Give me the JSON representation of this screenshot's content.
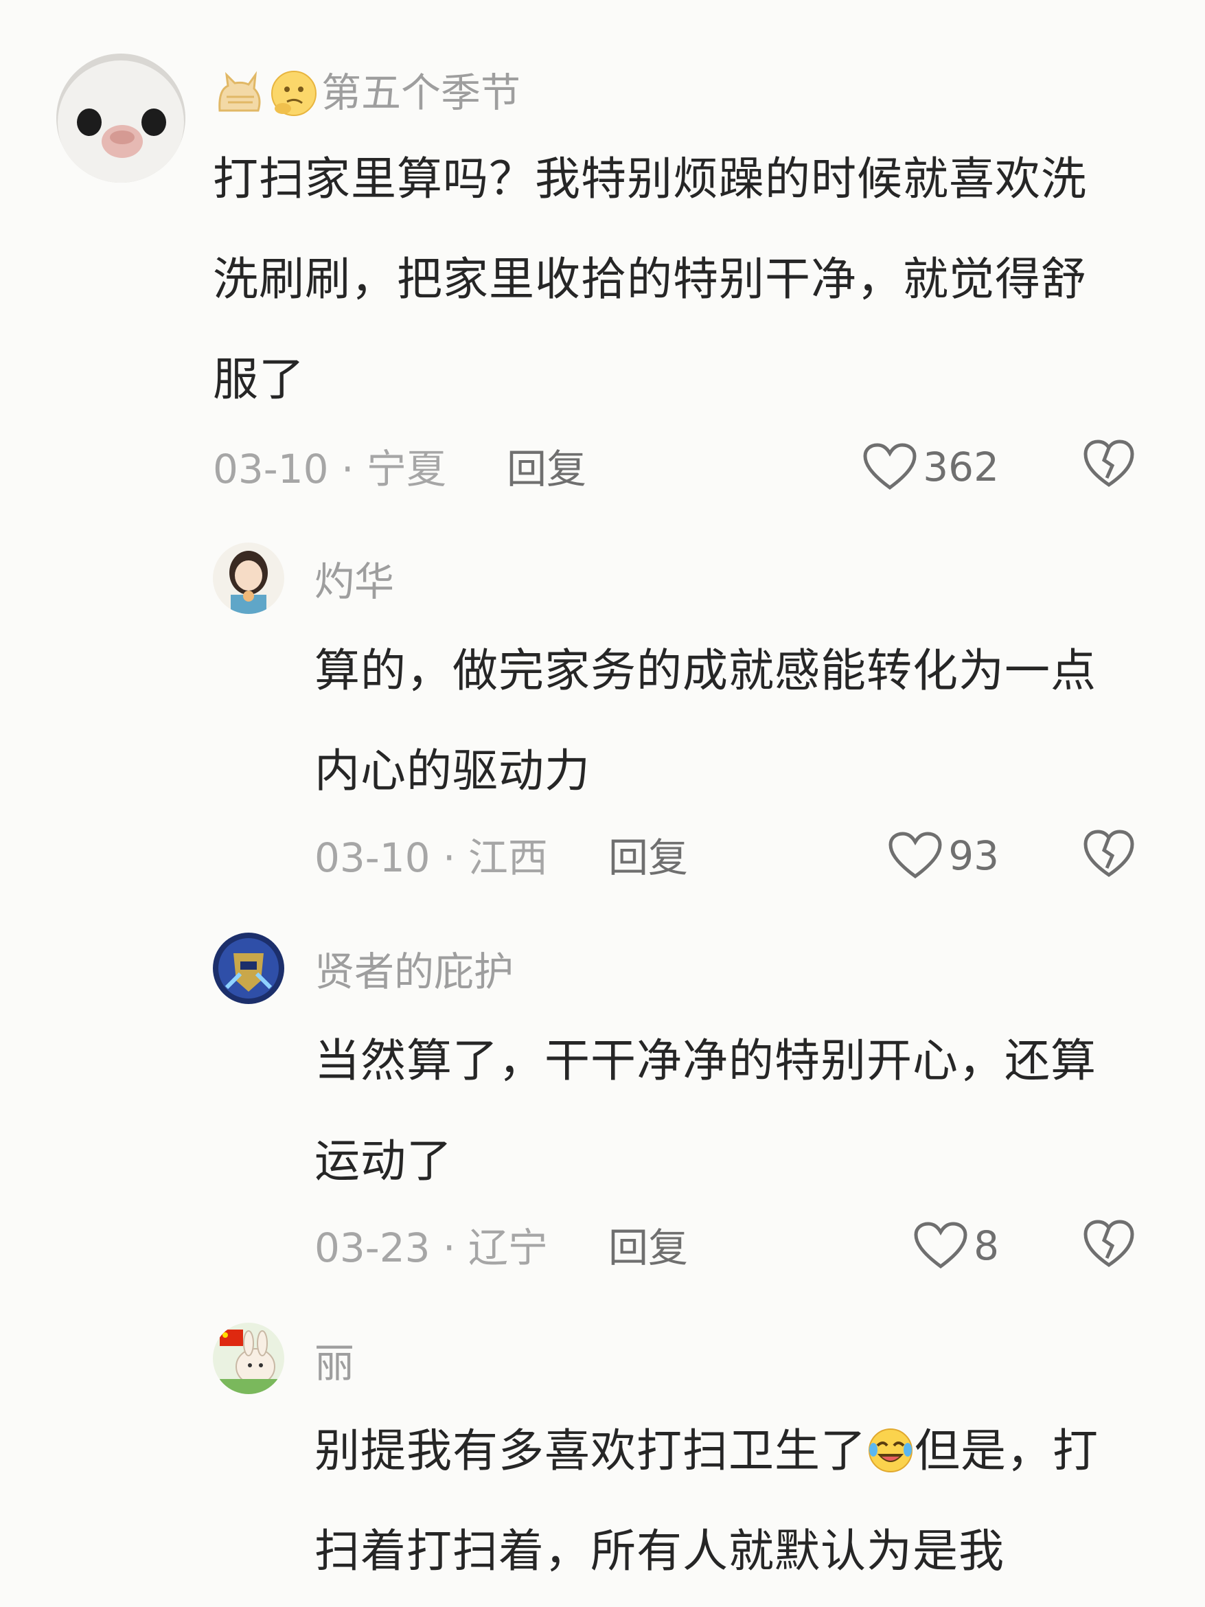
{
  "comments": [
    {
      "username": "第五个季节",
      "content": "打扫家里算吗？我特别烦躁的时候就喜欢洗洗刷刷，把家里收拾的特别干净，就觉得舒服了",
      "meta": "03-10 · 宁夏",
      "reply_label": "回复",
      "likes": "362"
    },
    {
      "username": "灼华",
      "content": "算的，做完家务的成就感能转化为一点内心的驱动力",
      "meta": "03-10 · 江西",
      "reply_label": "回复",
      "likes": "93"
    },
    {
      "username": "贤者的庇护",
      "content": "当然算了，干干净净的特别开心，还算运动了",
      "meta": "03-23 · 辽宁",
      "reply_label": "回复",
      "likes": "8"
    },
    {
      "username": "丽",
      "content_before_emoji": "别提我有多喜欢打扫卫生了",
      "content_after_emoji": "但是，打扫着打扫着，所有人就默认为是我"
    }
  ],
  "icons": {
    "like": "heart-outline-icon",
    "dislike": "broken-heart-icon",
    "badge_1": "cat-icon",
    "badge_2": "thinking-face-icon",
    "inline_emoji": "rolling-laughing-face-icon"
  },
  "colors": {
    "background": "#fbfbf9",
    "username": "#9e9e9e",
    "content": "#262626",
    "meta": "#a6a6a6",
    "action": "#6f6f6f"
  }
}
